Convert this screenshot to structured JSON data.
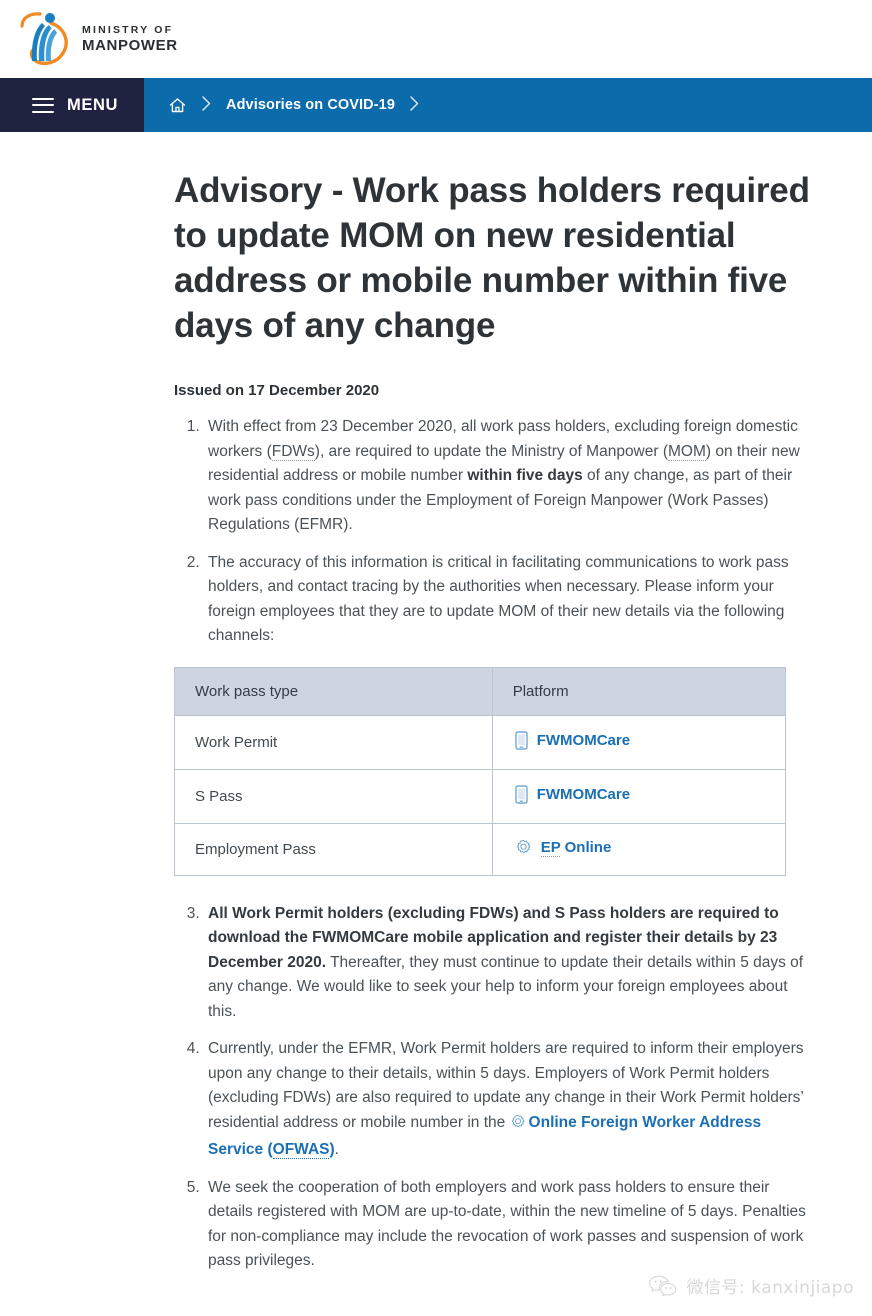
{
  "site": {
    "logo_line1": "MINISTRY OF",
    "logo_line2": "MANPOWER",
    "logo_icon": "mom-logo-icon",
    "colors": {
      "nav_blue": "#0b6bab",
      "menu_navy": "#1f2340",
      "link_blue": "#1a6fb5",
      "table_header": "#ced5e1",
      "table_border": "#b9c6d1",
      "body_text": "#4a5258",
      "heading_text": "#2e3338"
    }
  },
  "nav": {
    "menu_label": "MENU",
    "menu_icon": "hamburger-icon",
    "breadcrumb": {
      "home_icon": "home-icon",
      "separator_icon": "chevron-right-icon",
      "items": [
        {
          "label": "Advisories on COVID-19"
        }
      ]
    }
  },
  "article": {
    "title": "Advisory - Work pass holders required to update MOM on new residential address or mobile number within five days of any change",
    "issued": "Issued on 17 December 2020",
    "items": [
      {
        "id": 1,
        "parts": [
          {
            "t": "text",
            "v": "With effect from 23 December 2020, all work pass holders, excluding foreign domestic workers ("
          },
          {
            "t": "abbr",
            "v": "FDWs"
          },
          {
            "t": "text",
            "v": "), are required to update the Ministry of Manpower ("
          },
          {
            "t": "abbr",
            "v": "MOM"
          },
          {
            "t": "text",
            "v": ") on their new residential address or mobile number "
          },
          {
            "t": "bold",
            "v": "within five days"
          },
          {
            "t": "text",
            "v": " of any change, as part of their work pass conditions under the Employment of Foreign Manpower (Work Passes) Regulations (EFMR)."
          }
        ]
      },
      {
        "id": 2,
        "parts": [
          {
            "t": "text",
            "v": "The accuracy of this information is critical in facilitating communications to work pass holders, and contact tracing by the authorities when necessary. Please inform your foreign employees that they are to update MOM of their new details via the following channels:"
          }
        ]
      },
      {
        "id": 3,
        "parts": [
          {
            "t": "bold",
            "v": "All Work Permit holders (excluding FDWs) and S Pass holders are required to download the FWMOMCare mobile application and register their details by 23 December 2020."
          },
          {
            "t": "text",
            "v": " Thereafter, they must continue to update their details within 5 days of any change. We would like to seek your help to inform your foreign employees about this."
          }
        ]
      },
      {
        "id": 4,
        "parts": [
          {
            "t": "text",
            "v": "Currently, under the EFMR, Work Permit holders are required to inform their employers upon any change to their details, within 5 days. Employers of Work Permit holders (excluding FDWs) are also required to update any change in their Work Permit holders’ residential address or mobile number in the "
          },
          {
            "t": "link-gear",
            "v": "Online Foreign Worker Address Service (",
            "abbr": "OFWAS",
            "tail": ")"
          },
          {
            "t": "text",
            "v": "."
          }
        ]
      },
      {
        "id": 5,
        "parts": [
          {
            "t": "text",
            "v": "We seek the cooperation of both employers and work pass holders to ensure their details registered with MOM are up-to-date, within the new timeline of 5 days. Penalties for non-compliance may include the revocation of work passes and suspension of work pass privileges."
          }
        ]
      }
    ]
  },
  "table": {
    "headers": [
      "Work pass type",
      "Platform"
    ],
    "rows": [
      {
        "type": "Work Permit",
        "platform": "FWMOMCare",
        "icon": "mobile-phone-icon"
      },
      {
        "type": "S Pass",
        "platform": "FWMOMCare",
        "icon": "mobile-phone-icon"
      },
      {
        "type": "Employment Pass",
        "platform_abbr": "EP",
        "platform": " Online",
        "icon": "gear-icon"
      }
    ]
  },
  "watermark": {
    "icon": "wechat-icon",
    "text": "微信号: kanxinjiapo"
  }
}
